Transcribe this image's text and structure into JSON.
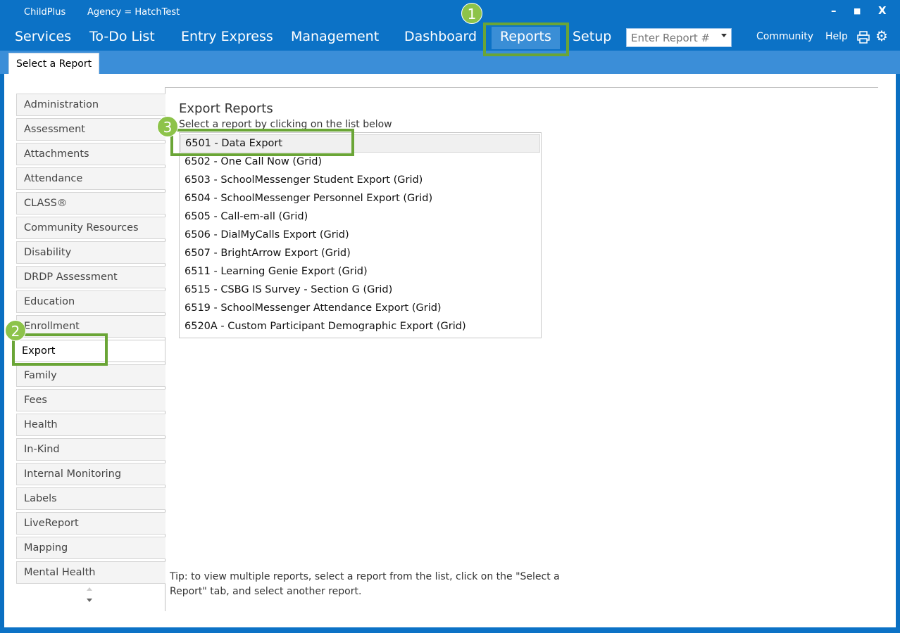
{
  "titlebar": {
    "app_name": "ChildPlus",
    "agency": "Agency = HatchTest",
    "minimize": "–",
    "maximize": "■",
    "close": "X"
  },
  "menu": {
    "items": [
      {
        "label": "Services"
      },
      {
        "label": "To-Do List"
      },
      {
        "label": "Entry Express"
      },
      {
        "label": "Management"
      },
      {
        "label": "Dashboard"
      },
      {
        "label": "Reports"
      },
      {
        "label": "Setup"
      }
    ],
    "active": "Reports",
    "report_input_placeholder": "Enter Report #",
    "community": "Community",
    "help": "Help"
  },
  "tabs": {
    "active_tab": "Select a Report"
  },
  "categories": {
    "items": [
      "Administration",
      "Assessment",
      "Attachments",
      "Attendance",
      "CLASS®",
      "Community Resources",
      "Disability",
      "DRDP Assessment",
      "Education",
      "Enrollment",
      "Export",
      "Family",
      "Fees",
      "Health",
      "In-Kind",
      "Internal Monitoring",
      "Labels",
      "LiveReport",
      "Mapping",
      "Mental Health"
    ],
    "selected": "Export"
  },
  "reports": {
    "title": "Export Reports",
    "subtitle": "Select a report by clicking on the list below",
    "items": [
      "6501 - Data Export",
      "6502 - One Call Now (Grid)",
      "6503 - SchoolMessenger Student Export (Grid)",
      "6504 - SchoolMessenger Personnel Export (Grid)",
      "6505 - Call-em-all (Grid)",
      "6506 - DialMyCalls Export (Grid)",
      "6507 - BrightArrow Export (Grid)",
      "6511 - Learning Genie Export (Grid)",
      "6515 - CSBG IS Survey - Section G (Grid)",
      "6519 - SchoolMessenger Attendance Export (Grid)",
      "6520A - Custom Participant Demographic Export (Grid)"
    ],
    "selected": "6501 - Data Export",
    "tip": "Tip: to view multiple reports, select a report from the list, click on the \"Select a Report\" tab, and select another report."
  },
  "callouts": {
    "one": "1",
    "two": "2",
    "three": "3",
    "color": "#6aa536"
  }
}
